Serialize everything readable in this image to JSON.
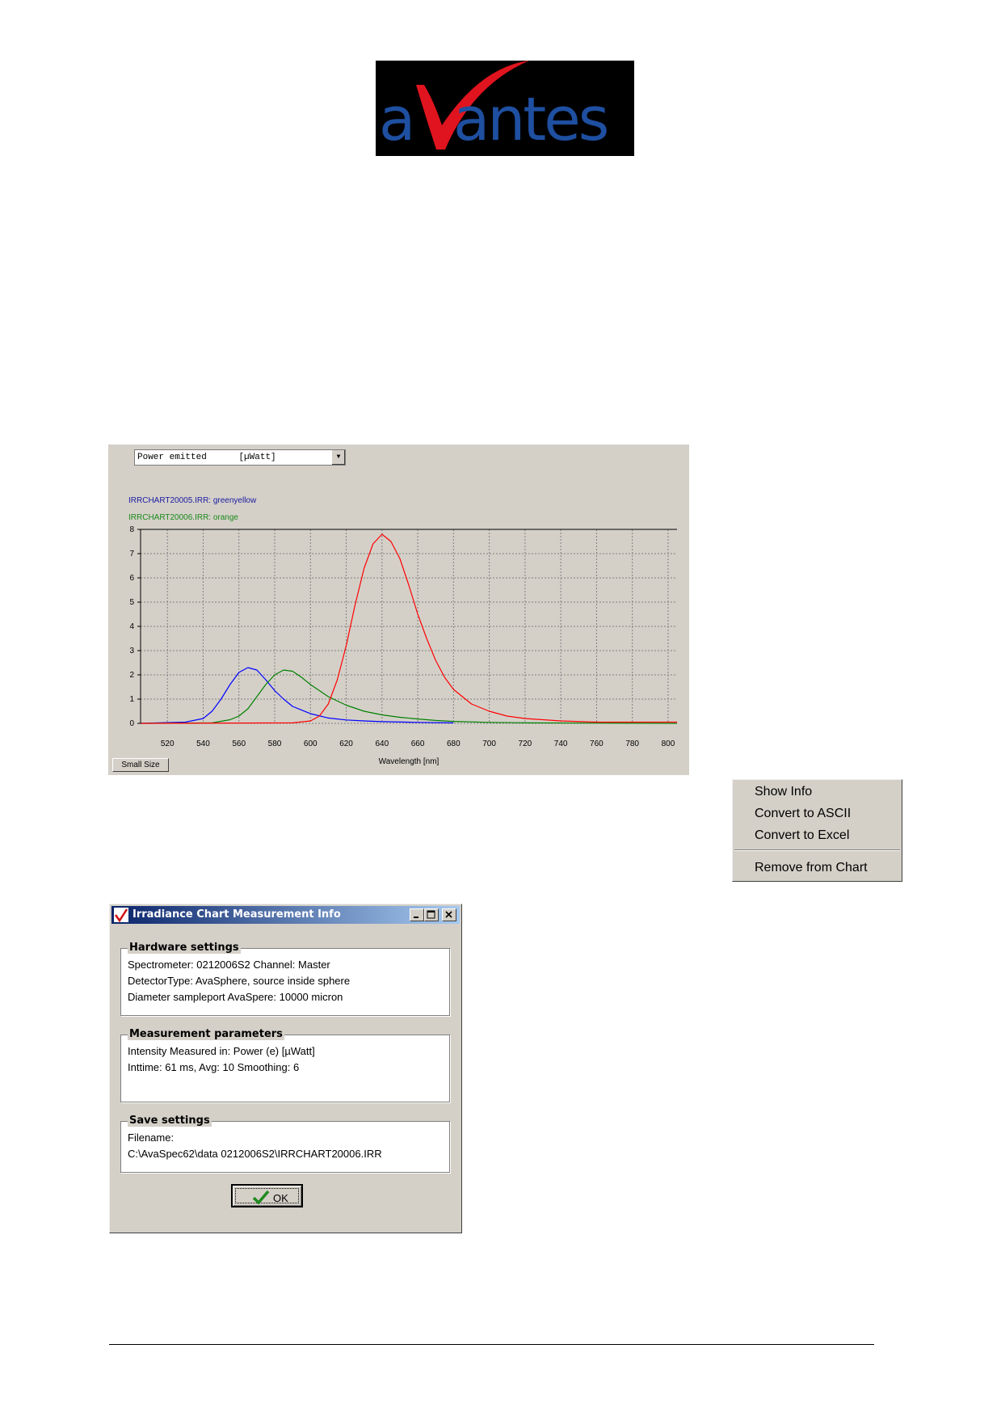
{
  "logo": {
    "text": "avantes",
    "colors": {
      "background": "#000000",
      "letters": "#1e4fa0",
      "swoosh": "#e0141e"
    }
  },
  "chart_panel": {
    "quantity_select": {
      "value": "Power emitted",
      "unit": "[µWatt]"
    },
    "legend": [
      {
        "text": "IRRCHART20005.IRR: greenyellow",
        "color": "#1a1aa0"
      },
      {
        "text": "IRRCHART20006.IRR: orange",
        "color": "#1a8a1a"
      }
    ],
    "small_size_button": "Small Size"
  },
  "chart_data": {
    "type": "line",
    "xlabel": "Wavelength [nm]",
    "ylabel": "",
    "xlim": [
      505,
      805
    ],
    "ylim": [
      0,
      8
    ],
    "grid": true,
    "x_ticks": [
      "520",
      "540",
      "560",
      "580",
      "600",
      "620",
      "640",
      "660",
      "680",
      "700",
      "720",
      "740",
      "760",
      "780",
      "800"
    ],
    "y_ticks": [
      "0",
      "1",
      "2",
      "3",
      "4",
      "5",
      "6",
      "7",
      "8"
    ],
    "series": [
      {
        "name": "IRRCHART20005.IRR: greenyellow",
        "color": "#0000ff",
        "x": [
          505,
          530,
          540,
          545,
          550,
          555,
          560,
          565,
          570,
          575,
          580,
          585,
          590,
          600,
          610,
          620,
          630,
          640,
          660,
          680
        ],
        "y": [
          0,
          0.05,
          0.2,
          0.5,
          1.0,
          1.6,
          2.1,
          2.3,
          2.2,
          1.8,
          1.35,
          1.0,
          0.7,
          0.4,
          0.22,
          0.14,
          0.1,
          0.07,
          0.04,
          0.02
        ]
      },
      {
        "name": "IRRCHART20006.IRR: orange",
        "color": "#008000",
        "x": [
          505,
          545,
          555,
          560,
          565,
          570,
          575,
          580,
          585,
          590,
          595,
          600,
          610,
          620,
          630,
          640,
          650,
          660,
          670,
          680,
          700,
          720,
          760,
          805
        ],
        "y": [
          0,
          0.02,
          0.15,
          0.3,
          0.6,
          1.1,
          1.6,
          2.0,
          2.2,
          2.15,
          1.9,
          1.6,
          1.1,
          0.75,
          0.5,
          0.35,
          0.25,
          0.18,
          0.12,
          0.08,
          0.04,
          0.02,
          0.01,
          0
        ]
      },
      {
        "name": "",
        "color": "#ff0000",
        "x": [
          505,
          590,
          600,
          605,
          610,
          615,
          620,
          625,
          630,
          635,
          640,
          645,
          650,
          655,
          660,
          665,
          670,
          675,
          680,
          690,
          700,
          710,
          720,
          740,
          760,
          805
        ],
        "y": [
          0,
          0.02,
          0.1,
          0.3,
          0.8,
          1.8,
          3.2,
          4.9,
          6.4,
          7.4,
          7.8,
          7.5,
          6.8,
          5.7,
          4.5,
          3.5,
          2.6,
          1.9,
          1.4,
          0.8,
          0.5,
          0.3,
          0.2,
          0.1,
          0.05,
          0.05
        ]
      }
    ]
  },
  "context_menu": {
    "items": [
      "Show Info",
      "Convert to ASCII",
      "Convert to Excel"
    ],
    "remove": "Remove from Chart"
  },
  "dialog": {
    "title": "Irradiance Chart Measurement Info",
    "hardware": {
      "title": "Hardware settings",
      "lines": [
        "Spectrometer: 0212006S2  Channel: Master",
        "DetectorType: AvaSphere, source inside sphere",
        "Diameter sampleport AvaSpere: 10000 micron"
      ]
    },
    "measurement": {
      "title": "Measurement parameters",
      "lines": [
        "Intensity Measured in: Power (e) [µWatt]",
        "Inttime: 61 ms, Avg: 10 Smoothing: 6"
      ]
    },
    "save": {
      "title": "Save settings",
      "lines": [
        "Filename:",
        "C:\\AvaSpec62\\data 0212006S2\\IRRCHART20006.IRR"
      ]
    },
    "ok_label": "OK"
  }
}
